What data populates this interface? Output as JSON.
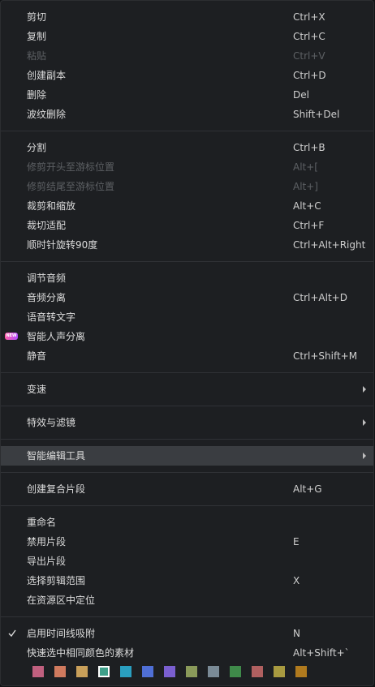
{
  "menu": {
    "items": [
      {
        "label": "剪切",
        "shortcut": "Ctrl+X"
      },
      {
        "label": "复制",
        "shortcut": "Ctrl+C"
      },
      {
        "label": "粘贴",
        "shortcut": "Ctrl+V"
      },
      {
        "label": "创建副本",
        "shortcut": "Ctrl+D"
      },
      {
        "label": "删除",
        "shortcut": "Del"
      },
      {
        "label": "波纹删除",
        "shortcut": "Shift+Del"
      },
      {
        "label": "分割",
        "shortcut": "Ctrl+B"
      },
      {
        "label": "修剪开头至游标位置",
        "shortcut": "Alt+["
      },
      {
        "label": "修剪结尾至游标位置",
        "shortcut": "Alt+]"
      },
      {
        "label": "裁剪和缩放",
        "shortcut": "Alt+C"
      },
      {
        "label": "裁切适配",
        "shortcut": "Ctrl+F"
      },
      {
        "label": "顺时针旋转90度",
        "shortcut": "Ctrl+Alt+Right"
      },
      {
        "label": "调节音频",
        "shortcut": ""
      },
      {
        "label": "音频分离",
        "shortcut": "Ctrl+Alt+D"
      },
      {
        "label": "语音转文字",
        "shortcut": ""
      },
      {
        "label": "智能人声分离",
        "shortcut": "",
        "badge": "NEW"
      },
      {
        "label": "静音",
        "shortcut": "Ctrl+Shift+M"
      },
      {
        "label": "变速",
        "shortcut": ""
      },
      {
        "label": "特效与滤镜",
        "shortcut": ""
      },
      {
        "label": "智能编辑工具",
        "shortcut": ""
      },
      {
        "label": "创建复合片段",
        "shortcut": "Alt+G"
      },
      {
        "label": "重命名",
        "shortcut": ""
      },
      {
        "label": "禁用片段",
        "shortcut": "E"
      },
      {
        "label": "导出片段",
        "shortcut": ""
      },
      {
        "label": "选择剪辑范围",
        "shortcut": "X"
      },
      {
        "label": "在资源区中定位",
        "shortcut": ""
      },
      {
        "label": "启用时间线吸附",
        "shortcut": "N"
      },
      {
        "label": "快速选中相同颜色的素材",
        "shortcut": "Alt+Shift+`"
      }
    ],
    "color_swatches": [
      "#c0607f",
      "#d07a5e",
      "#c9a05a",
      "#3ea08a",
      "#2a9fc0",
      "#4f6fd6",
      "#7a5fd0",
      "#8a9a5a",
      "#7a8a96",
      "#3f8a4a",
      "#b06060",
      "#a89a40",
      "#b07a1e"
    ],
    "selected_swatch_index": 3
  }
}
